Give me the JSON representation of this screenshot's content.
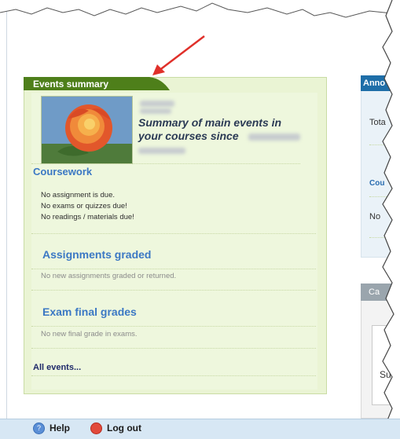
{
  "events_panel": {
    "tab_title": "Events summary",
    "summary_heading": "Summary of main events in your courses since",
    "coursework": {
      "title": "Coursework",
      "items": [
        "No assignment is due.",
        "No exams or quizzes due!",
        "No readings / materials due!"
      ]
    },
    "assignments_graded": {
      "title": "Assignments graded",
      "message": "No new assignments graded or returned."
    },
    "exam_final_grades": {
      "title": "Exam final grades",
      "message": "No new final grade in exams."
    },
    "all_events_link": "All events..."
  },
  "right_panels": {
    "announcements_tab": "Anno",
    "total_label": "Tota",
    "course_link": "Cou",
    "no_label": "No",
    "calendar_tab": "Ca",
    "sub_label": "Su"
  },
  "footer": {
    "help_label": "Help",
    "logout_label": "Log out"
  },
  "colors": {
    "panel_green": "#eaf4d4",
    "tab_green": "#4e7f1a",
    "link_blue": "#3b78c4",
    "arrow_red": "#e0302a",
    "footer_blue": "#d7e7f4"
  },
  "icons": [
    "help-icon",
    "logout-icon",
    "flower-image"
  ]
}
